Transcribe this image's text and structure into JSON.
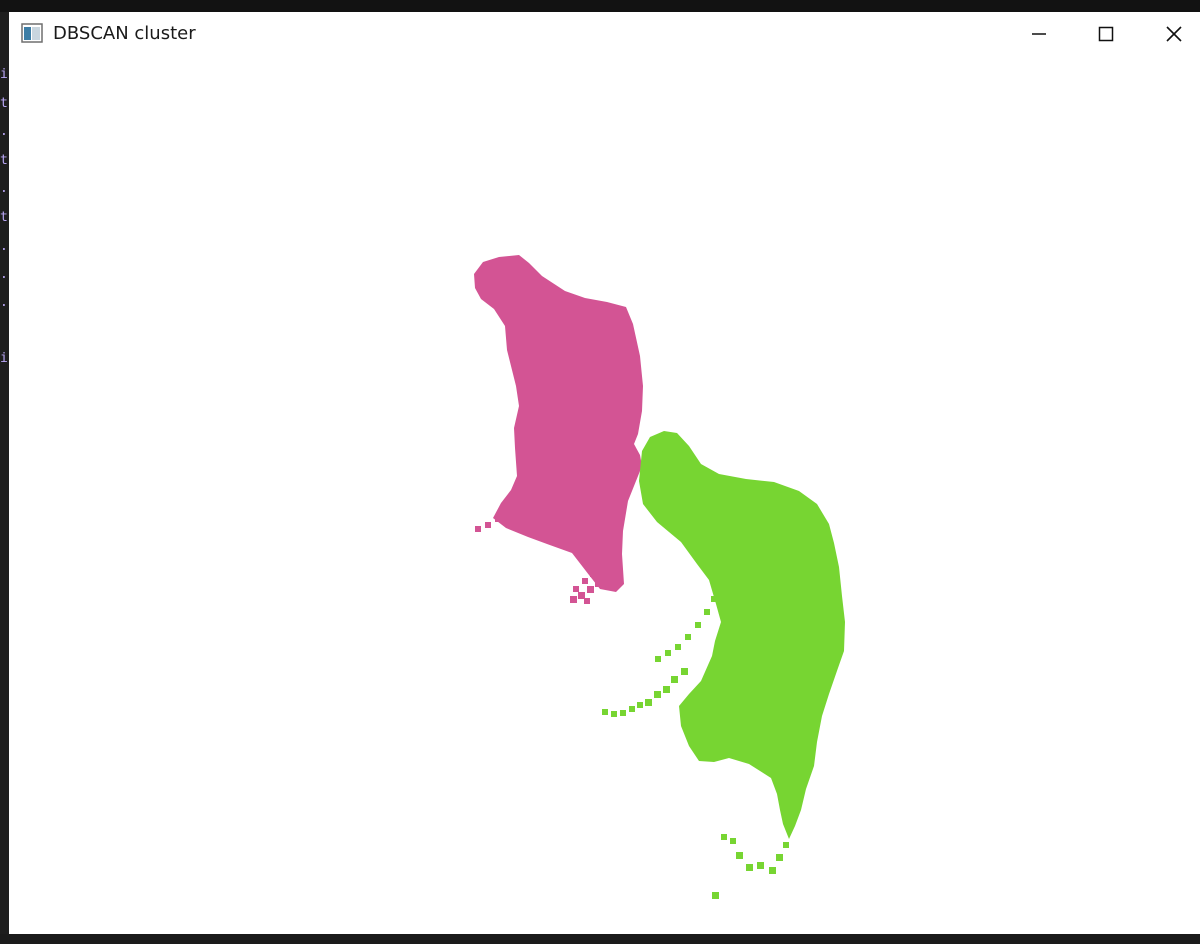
{
  "window": {
    "title": "DBSCAN cluster",
    "icon": "app-window-icon",
    "controls": {
      "minimize_icon": "minimize-icon",
      "maximize_icon": "maximize-icon",
      "close_icon": "close-icon"
    }
  },
  "backdrop": {
    "editor_glyphs": [
      "i",
      "t",
      ".",
      "t",
      ".",
      "t",
      ".",
      ".",
      ".",
      "i"
    ]
  },
  "point_cloud": {
    "clusters": [
      {
        "name": "",
        "color": "#d35494"
      },
      {
        "name": "",
        "color": "#77d532"
      }
    ]
  }
}
